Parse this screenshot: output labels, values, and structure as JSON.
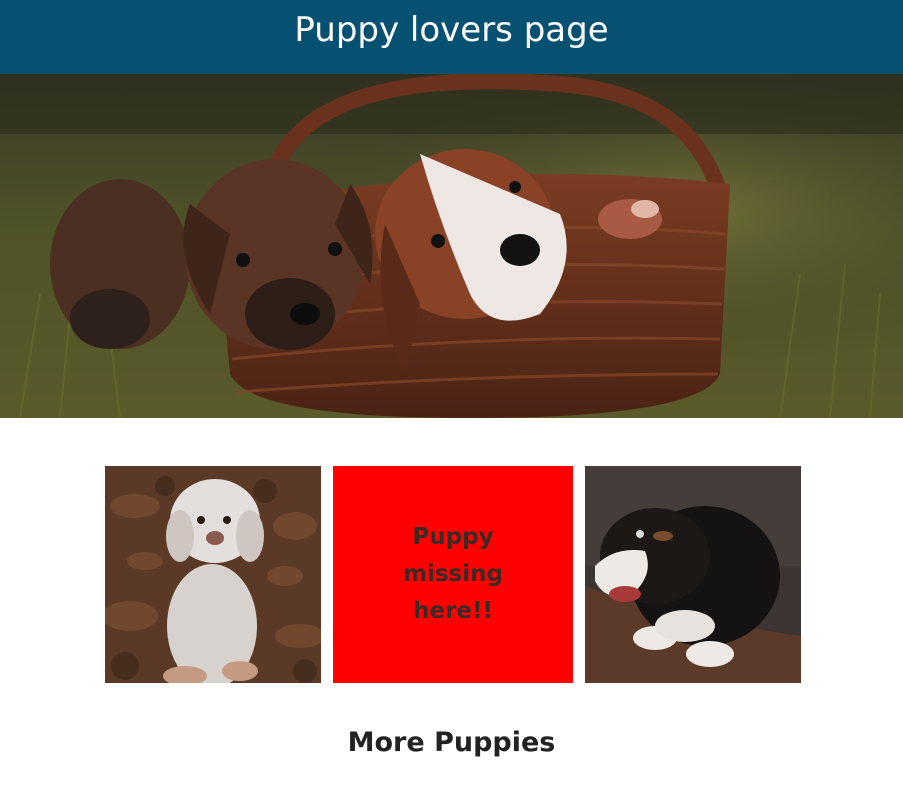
{
  "header": {
    "title": "Puppy lovers page"
  },
  "hero": {
    "image": "three-puppies-in-wicker-basket-photo"
  },
  "gallery": {
    "tiles": [
      {
        "image": "white-curly-puppy-photo"
      },
      {
        "placeholder_text": "Puppy missing here!!",
        "background": "#ff0000"
      },
      {
        "image": "black-and-white-puppy-photo"
      }
    ]
  },
  "section": {
    "title": "More Puppies"
  },
  "colors": {
    "header_bg": "#065071",
    "header_text": "#ffffff",
    "missing_tile_bg": "#ff0000",
    "missing_tile_text": "#3a2a26"
  }
}
